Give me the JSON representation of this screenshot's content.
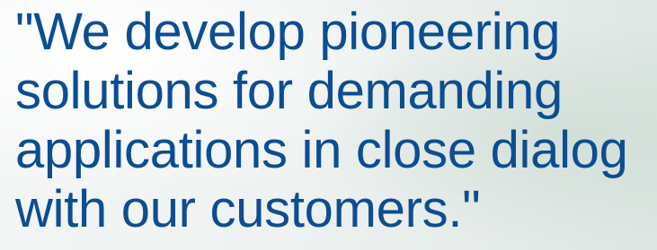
{
  "quote": {
    "lines": [
      "\"We develop pioneering",
      "solutions for demanding",
      "applications in close dialog",
      "with our customers.\""
    ]
  },
  "colors": {
    "text": "#0d4d92",
    "background": "#eef2f1"
  }
}
